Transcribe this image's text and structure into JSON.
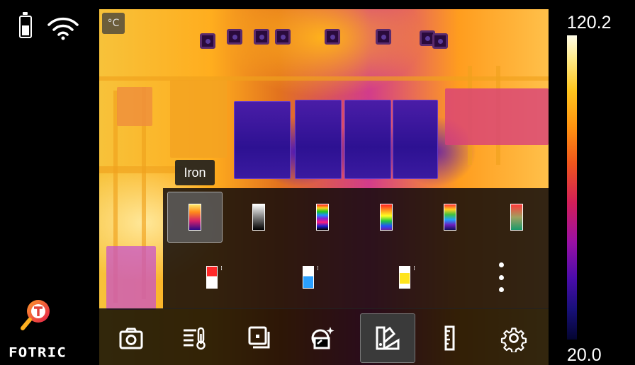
{
  "status": {
    "battery_icon": "battery-icon",
    "wifi_icon": "wifi-icon"
  },
  "brand": {
    "name": "FOTRIC",
    "logo_icon": "fotric-magnifier-logo-icon"
  },
  "viewer": {
    "unit": "°C"
  },
  "palette_popup": {
    "selected_label": "Iron",
    "palettes": [
      {
        "name": "iron-palette-icon",
        "selected": true
      },
      {
        "name": "gray-palette-icon",
        "selected": false
      },
      {
        "name": "rainbow-hc-palette-icon",
        "selected": false
      },
      {
        "name": "rainbow-palette-icon",
        "selected": false
      },
      {
        "name": "rainbow-alt-palette-icon",
        "selected": false
      },
      {
        "name": "red-green-palette-icon",
        "selected": false
      }
    ],
    "sub_palettes": [
      {
        "name": "red-alarm-palette-icon"
      },
      {
        "name": "blue-alarm-palette-icon"
      },
      {
        "name": "yellow-alarm-palette-icon"
      }
    ],
    "more_icon": "more-vertical-icon"
  },
  "toolbar": {
    "items": [
      {
        "name": "camera-icon",
        "active": false
      },
      {
        "name": "temperature-measure-icon",
        "active": false
      },
      {
        "name": "image-mode-icon",
        "active": false
      },
      {
        "name": "image-enhance-icon",
        "active": false
      },
      {
        "name": "palette-icon",
        "active": true
      },
      {
        "name": "scale-ruler-icon",
        "active": false
      },
      {
        "name": "settings-gear-icon",
        "active": false
      }
    ]
  },
  "color_scale": {
    "max": "120.2",
    "min": "20.0",
    "colors": [
      "#fffde8",
      "#ffc61e",
      "#f0561c",
      "#9a10a5",
      "#18107a",
      "#040530"
    ]
  }
}
